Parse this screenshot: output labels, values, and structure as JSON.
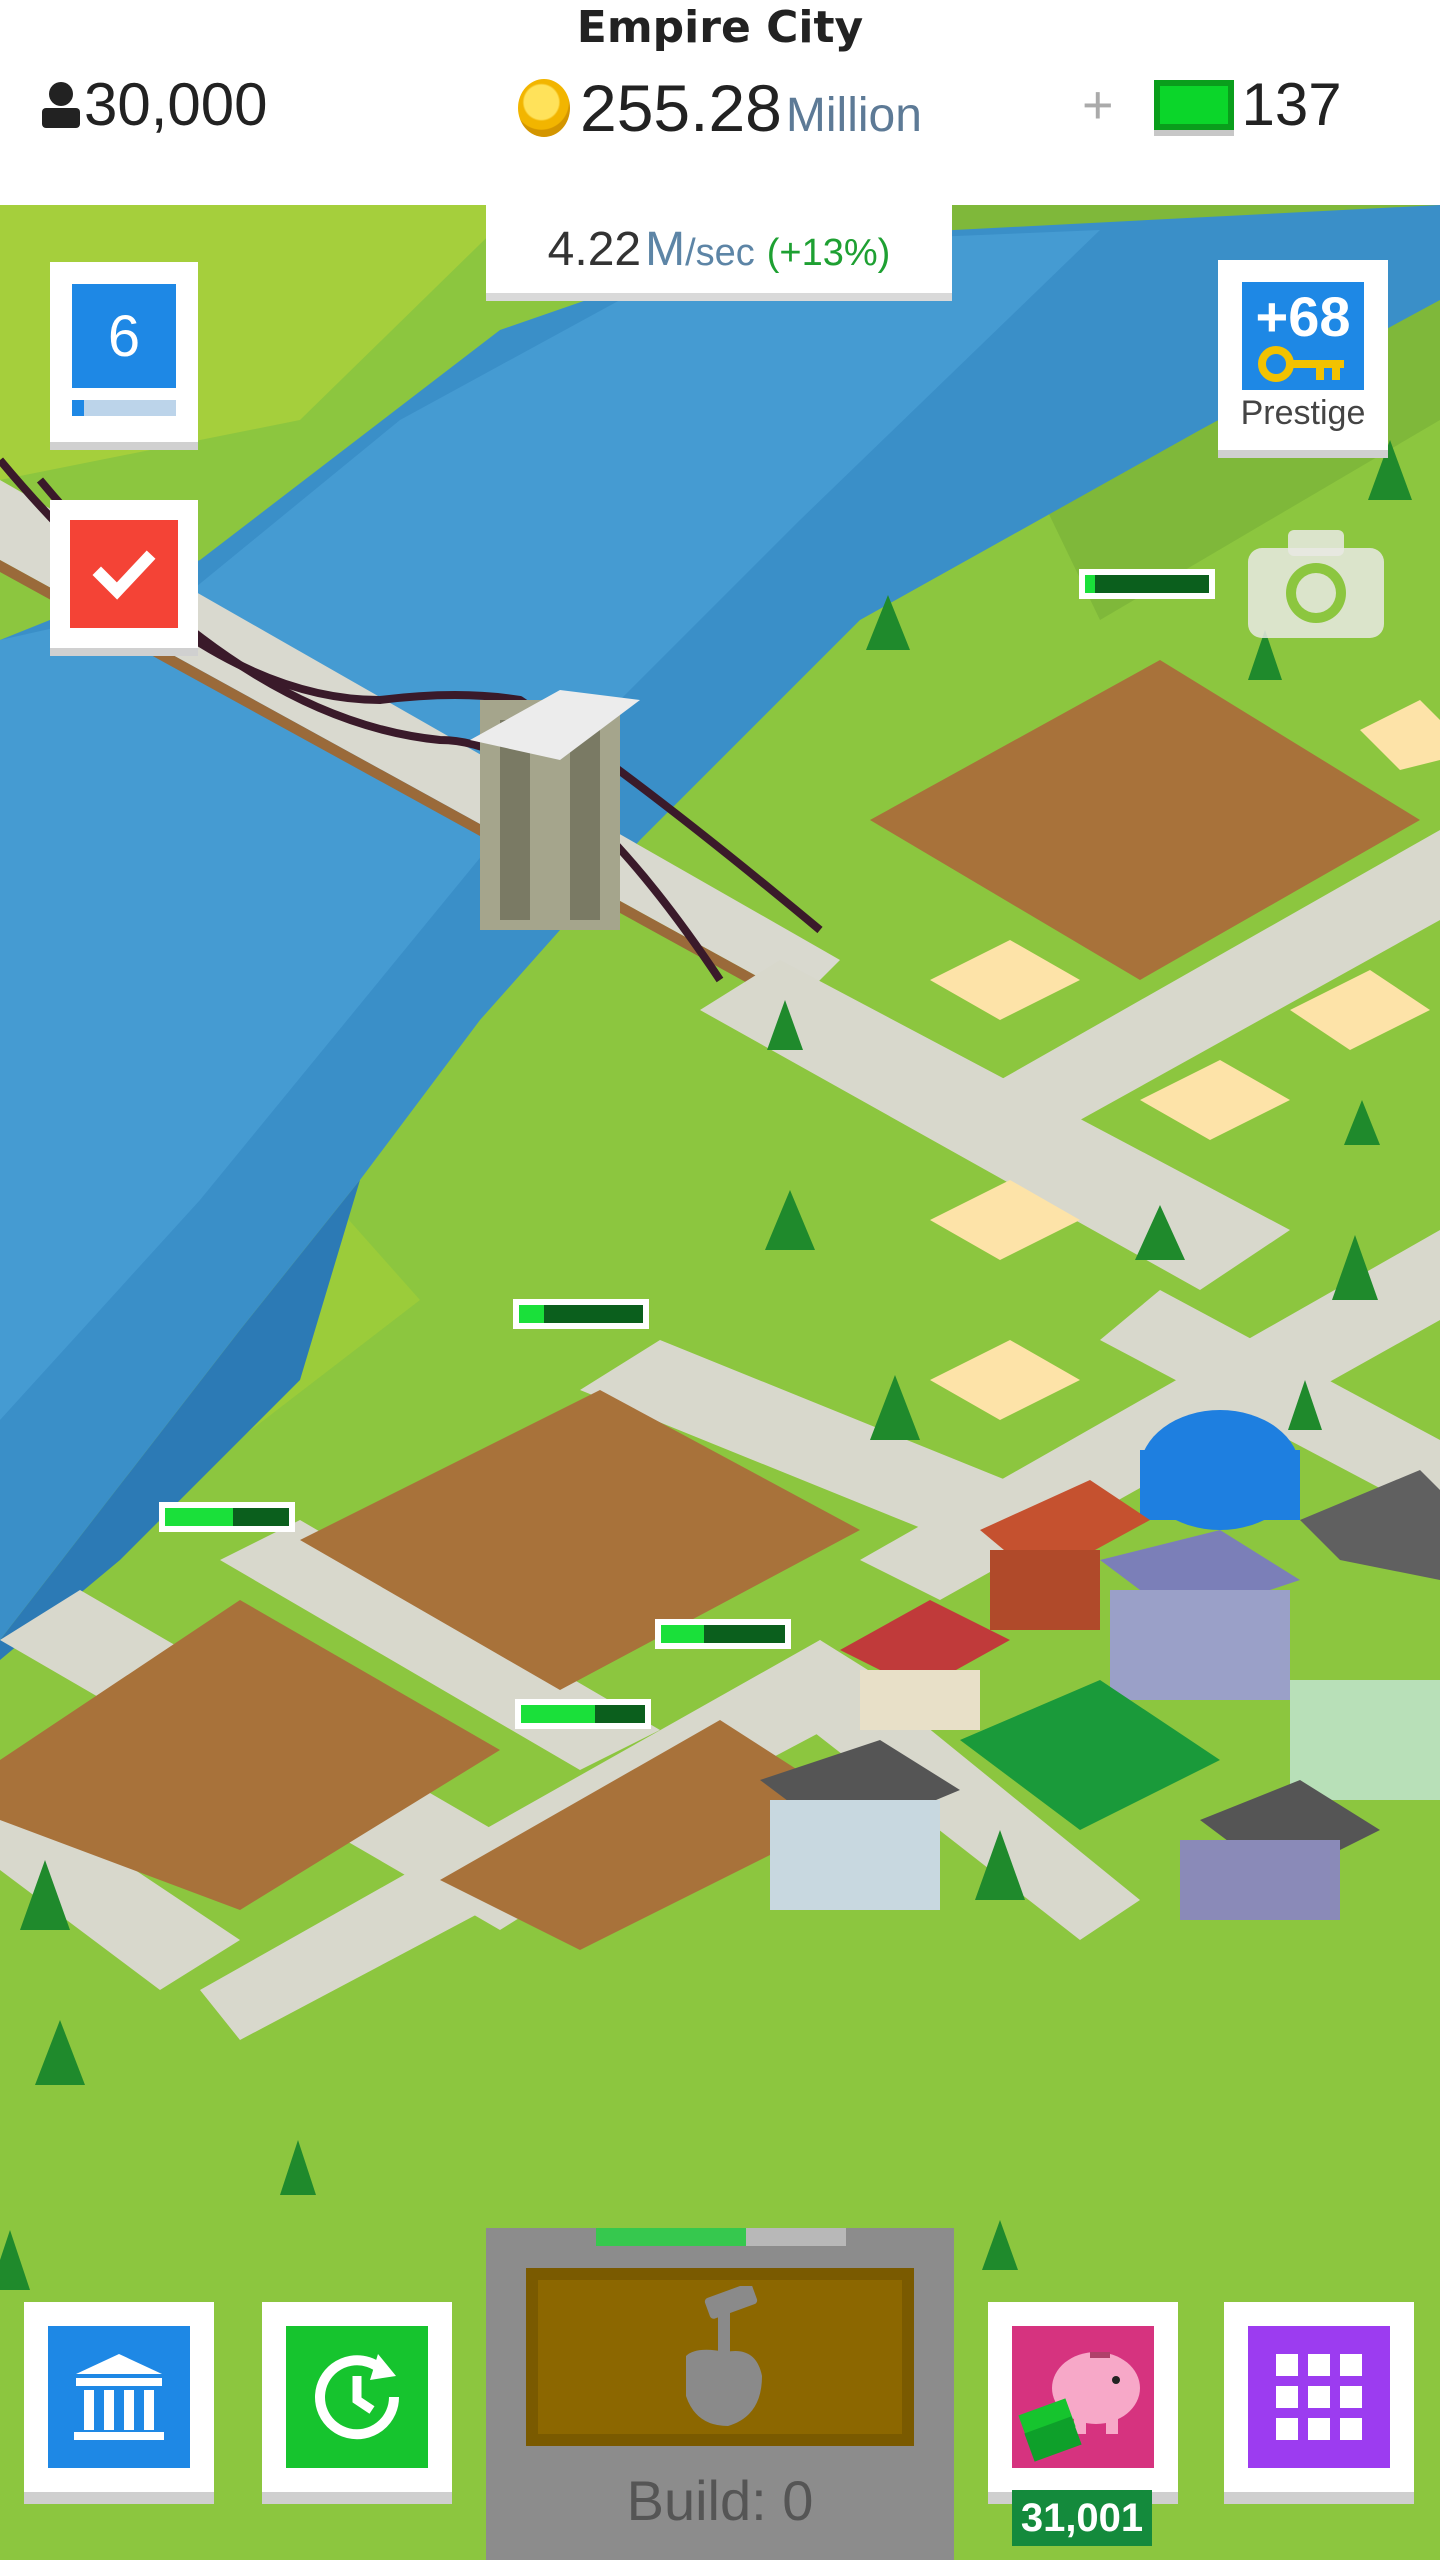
{
  "header": {
    "city_name": "Empire City",
    "population": "30,000",
    "money_value": "255.28",
    "money_unit": "Million",
    "cash_plus": "+",
    "cash_value": "137"
  },
  "income": {
    "value": "4.22",
    "unit": "M",
    "per": "/sec",
    "bonus": "(+13%)"
  },
  "level": {
    "number": "6",
    "progress": 0.12
  },
  "prestige": {
    "count": "+68",
    "label": "Prestige"
  },
  "build": {
    "label": "Build: 0",
    "progress": 0.6
  },
  "piggy_bank": {
    "count": "31,001"
  },
  "map_progress_bars": [
    {
      "id": "plot-top-right",
      "progress": 0.08
    },
    {
      "id": "plot-mid-left",
      "progress": 0.2
    },
    {
      "id": "plot-left",
      "progress": 0.55
    },
    {
      "id": "plot-center",
      "progress": 0.35
    },
    {
      "id": "plot-lower",
      "progress": 0.6
    }
  ],
  "icons": {
    "population": "person-icon",
    "money": "coin-icon",
    "cash": "cash-bill-icon",
    "task": "checkmark-icon",
    "prestige": "key-icon",
    "camera": "camera-icon",
    "bank": "bank-icon",
    "boost": "clock-refresh-icon",
    "build": "hammer-hand-icon",
    "piggy": "piggy-bank-icon",
    "menu": "grid-menu-icon"
  },
  "colors": {
    "grass": "#8cc63f",
    "water": "#3a8fc8",
    "dirt": "#a8723a",
    "road": "#d8d8cc",
    "level_blue": "#1e88e5",
    "task_red": "#f44336",
    "boost_green": "#16c42e",
    "menu_purple": "#9c3cf0",
    "piggy_pink": "#d6337f"
  }
}
